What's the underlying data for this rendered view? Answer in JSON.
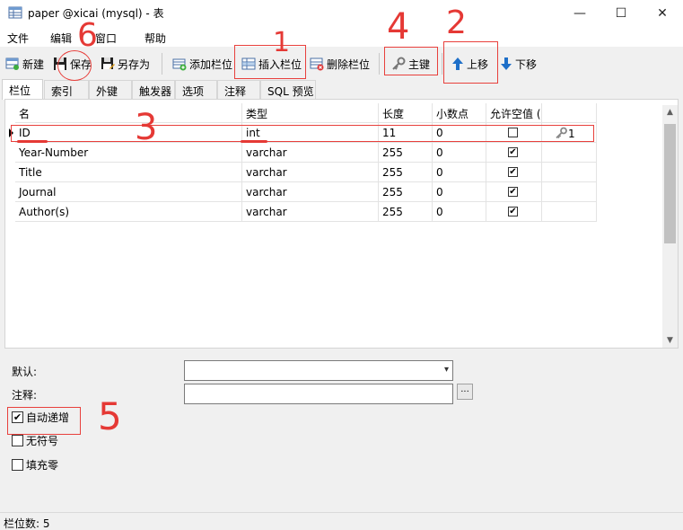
{
  "window": {
    "title": "paper @xicai (mysql) - 表",
    "minimize": "—",
    "maximize": "☐",
    "close": "✕"
  },
  "menu": [
    "文件",
    "编辑",
    "窗口",
    "帮助"
  ],
  "toolbar": {
    "new": "新建",
    "save": "保存",
    "save_as": "另存为",
    "add_field": "添加栏位",
    "insert_field": "插入栏位",
    "delete_field": "删除栏位",
    "primary_key": "主键",
    "move_up": "上移",
    "move_down": "下移"
  },
  "tabs": [
    "栏位",
    "索引",
    "外键",
    "触发器",
    "选项",
    "注释",
    "SQL 预览"
  ],
  "grid": {
    "headers": [
      "名",
      "类型",
      "长度",
      "小数点",
      "允许空值 ("
    ],
    "rows": [
      {
        "name": "ID",
        "type": "int",
        "length": "11",
        "decimals": "0",
        "nullable": false,
        "key": "1"
      },
      {
        "name": "Year-Number",
        "type": "varchar",
        "length": "255",
        "decimals": "0",
        "nullable": true,
        "key": ""
      },
      {
        "name": "Title",
        "type": "varchar",
        "length": "255",
        "decimals": "0",
        "nullable": true,
        "key": ""
      },
      {
        "name": "Journal",
        "type": "varchar",
        "length": "255",
        "decimals": "0",
        "nullable": true,
        "key": ""
      },
      {
        "name": "Author(s)",
        "type": "varchar",
        "length": "255",
        "decimals": "0",
        "nullable": true,
        "key": ""
      }
    ]
  },
  "properties": {
    "default_label": "默认:",
    "comment_label": "注释:",
    "ellipsis": "...",
    "auto_increment": {
      "label": "自动递增",
      "checked": true
    },
    "unsigned": {
      "label": "无符号",
      "checked": false
    },
    "zerofill": {
      "label": "填充零",
      "checked": false
    }
  },
  "status": {
    "text": "栏位数: 5"
  },
  "annotations": [
    "1",
    "2",
    "3",
    "4",
    "5",
    "6"
  ],
  "colors": {
    "annotation": "#e53935",
    "accent": "#1e6fc8"
  }
}
